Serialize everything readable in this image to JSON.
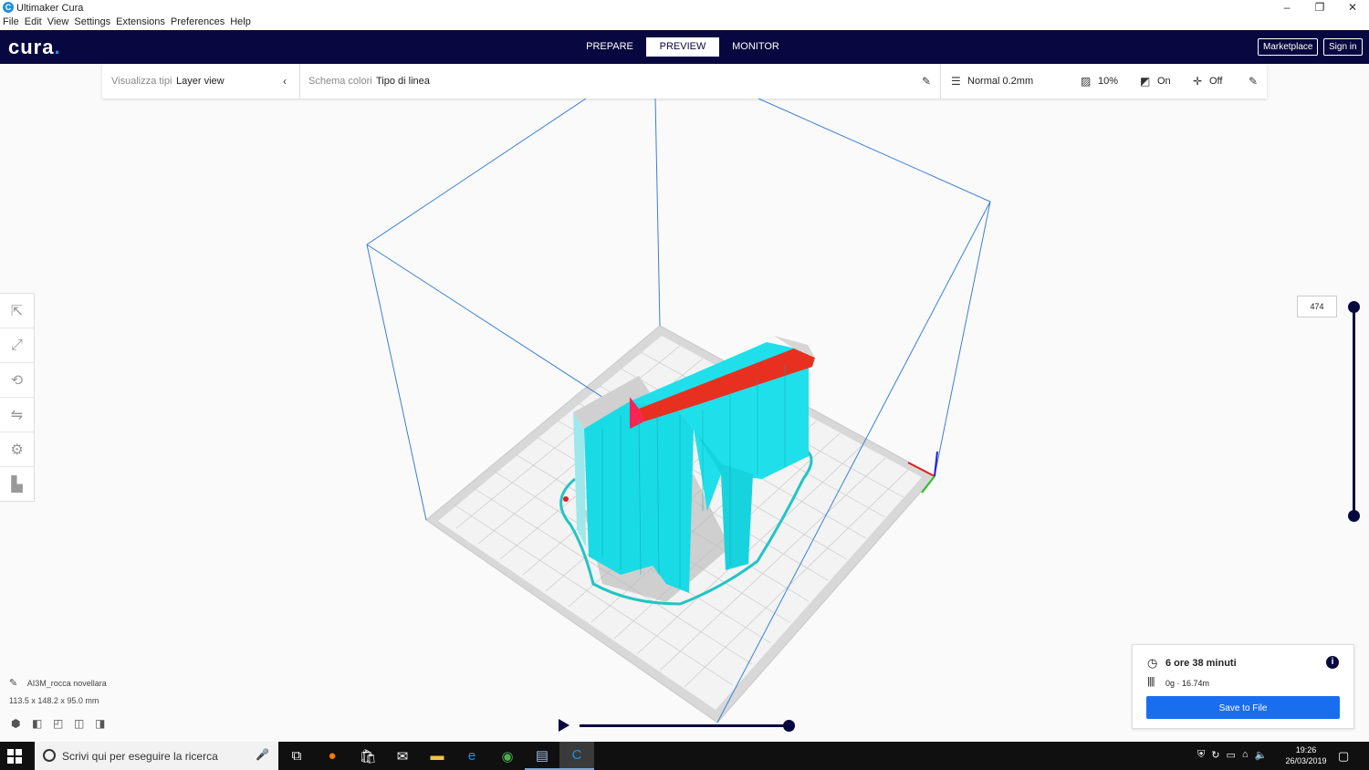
{
  "window": {
    "title": "Ultimaker Cura",
    "minimize": "–",
    "maximize": "❐",
    "close": "✕"
  },
  "menu": [
    "File",
    "Edit",
    "View",
    "Settings",
    "Extensions",
    "Preferences",
    "Help"
  ],
  "header": {
    "logo": "cura",
    "stages": [
      "PREPARE",
      "PREVIEW",
      "MONITOR"
    ],
    "active_stage": "PREVIEW",
    "marketplace": "Marketplace",
    "signin": "Sign in"
  },
  "viewbar": {
    "view_type_label": "Visualizza tipi",
    "view_type_value": "Layer view",
    "color_scheme_label": "Schema colori",
    "color_scheme_value": "Tipo di linea",
    "profile": "Normal 0.2mm",
    "infill": "10%",
    "support": "On",
    "adhesion": "Off"
  },
  "layer_slider": {
    "current_layer": "474"
  },
  "object": {
    "name": "AI3M_rocca novellara",
    "dimensions": "113.5 x 148.2 x 95.0 mm"
  },
  "print": {
    "time": "6 ore 38 minuti",
    "material": "0g · 16.74m",
    "save": "Save to File"
  },
  "taskbar": {
    "search_placeholder": "Scrivi qui per eseguire la ricerca",
    "time": "19:26",
    "date": "26/03/2019"
  },
  "colors": {
    "header": "#08073f",
    "accent": "#196ef0",
    "model": "#00e5ee",
    "top": "#ff2200"
  }
}
